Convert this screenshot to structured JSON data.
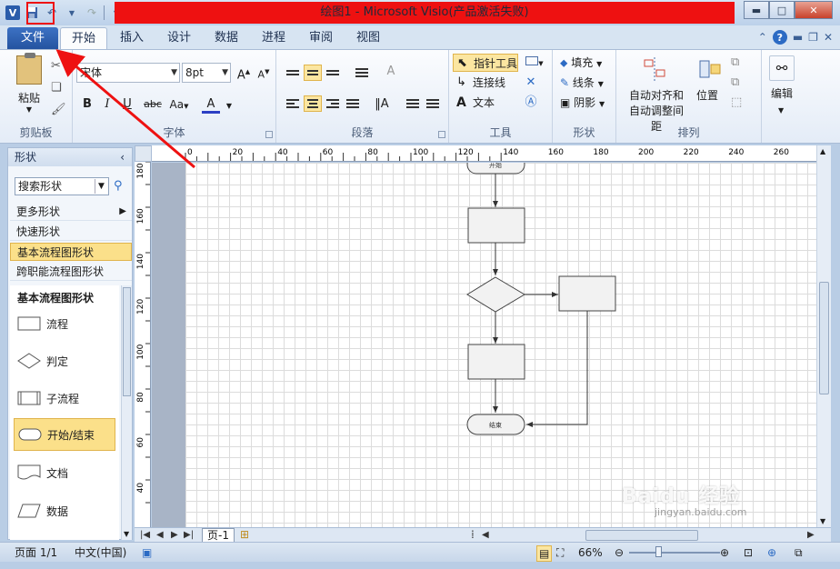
{
  "window": {
    "title": "绘图1 - Microsoft Visio(产品激活失败)",
    "app_icon": "V"
  },
  "tabs": {
    "file": "文件",
    "items": [
      "开始",
      "插入",
      "设计",
      "数据",
      "进程",
      "审阅",
      "视图"
    ]
  },
  "ribbon": {
    "clipboard": {
      "paste": "粘贴",
      "label": "剪贴板"
    },
    "font": {
      "name": "宋体",
      "size": "8pt",
      "label": "字体"
    },
    "paragraph": {
      "label": "段落"
    },
    "tools": {
      "pointer": "指针工具",
      "connector": "连接线",
      "text": "文本",
      "label": "工具"
    },
    "shape": {
      "fill": "填充",
      "line": "线条",
      "shadow": "阴影",
      "label": "形状"
    },
    "arrange": {
      "auto_align": "自动对齐和",
      "auto_space": "自动调整间距",
      "position": "位置",
      "label": "排列"
    },
    "edit": {
      "label": "编辑"
    }
  },
  "shapes_panel": {
    "title": "形状",
    "search": "搜索形状",
    "more": "更多形状",
    "quick": "快速形状",
    "basic": "基本流程图形状",
    "cross": "跨职能流程图形状",
    "stencil_title": "基本流程图形状",
    "items": [
      {
        "label": "流程"
      },
      {
        "label": "判定"
      },
      {
        "label": "子流程"
      },
      {
        "label": "开始/结束"
      },
      {
        "label": "文档"
      },
      {
        "label": "数据"
      }
    ]
  },
  "ruler": {
    "h": [
      "0",
      "20",
      "40",
      "60",
      "80",
      "100",
      "120",
      "140",
      "160",
      "180",
      "200",
      "220",
      "240",
      "260"
    ],
    "v": [
      "180",
      "160",
      "140",
      "120",
      "100",
      "80",
      "60",
      "40"
    ]
  },
  "diagram": {
    "start_label": "开始",
    "end_label": "结束"
  },
  "page_tab": "页-1",
  "status": {
    "page": "页面 1/1",
    "lang": "中文(中国)",
    "zoom": "66%"
  },
  "watermark": {
    "text": "Baidu 经验",
    "url": "jingyan.baidu.com"
  },
  "colors": {
    "highlight": "#ee1111",
    "ribbon_selected": "#fbe6a1",
    "file_tab": "#2453a0"
  }
}
